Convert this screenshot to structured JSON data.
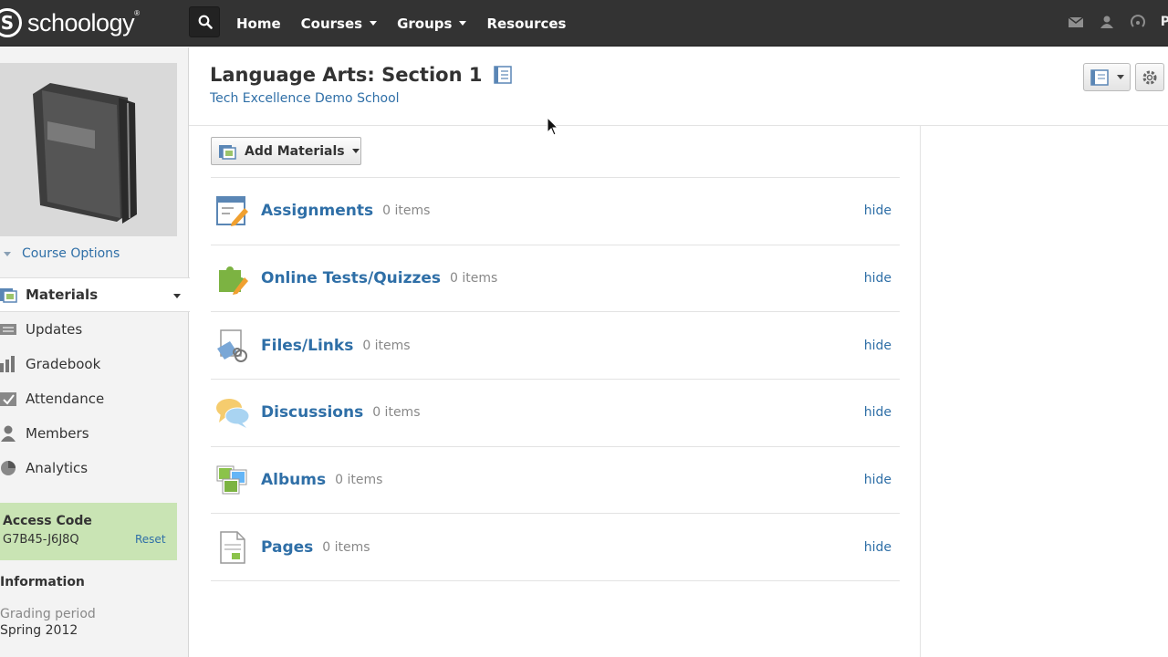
{
  "topbar": {
    "logo_text": "schoology",
    "logo_mark": "S",
    "nav": [
      {
        "label": "Home",
        "dropdown": false
      },
      {
        "label": "Courses",
        "dropdown": true
      },
      {
        "label": "Groups",
        "dropdown": true
      },
      {
        "label": "Resources",
        "dropdown": false
      }
    ],
    "right_icons": [
      "mail-icon",
      "requests-icon",
      "notifications-icon"
    ],
    "user_initial": "P"
  },
  "sidebar": {
    "course_options_label": "Course Options",
    "nav": [
      {
        "label": "Materials",
        "icon": "materials-icon",
        "active": true
      },
      {
        "label": "Updates",
        "icon": "updates-icon"
      },
      {
        "label": "Gradebook",
        "icon": "gradebook-icon"
      },
      {
        "label": "Attendance",
        "icon": "attendance-icon"
      },
      {
        "label": "Members",
        "icon": "members-icon"
      },
      {
        "label": "Analytics",
        "icon": "analytics-icon"
      }
    ],
    "access": {
      "title": "Access Code",
      "code": "G7B45-J6J8Q",
      "reset_label": "Reset"
    },
    "information": {
      "title": "Information",
      "grading_period_label": "Grading period",
      "grading_period_value": "Spring 2012"
    }
  },
  "main": {
    "title": "Language Arts: Section 1",
    "school": "Tech Excellence Demo School",
    "add_materials_label": "Add Materials",
    "items": [
      {
        "name": "Assignments",
        "count": "0 items",
        "hide": "hide",
        "icon": "assignment-icon"
      },
      {
        "name": "Online Tests/Quizzes",
        "count": "0 items",
        "hide": "hide",
        "icon": "quiz-puzzle-icon"
      },
      {
        "name": "Files/Links",
        "count": "0 items",
        "hide": "hide",
        "icon": "files-links-icon"
      },
      {
        "name": "Discussions",
        "count": "0 items",
        "hide": "hide",
        "icon": "discussion-bubbles-icon"
      },
      {
        "name": "Albums",
        "count": "0 items",
        "hide": "hide",
        "icon": "albums-icon"
      },
      {
        "name": "Pages",
        "count": "0 items",
        "hide": "hide",
        "icon": "page-icon"
      }
    ]
  },
  "colors": {
    "topbar": "#333333",
    "link": "#2f6fa7",
    "access_bg": "#c9e4b4",
    "sidebar_bg": "#f3f3f3"
  }
}
